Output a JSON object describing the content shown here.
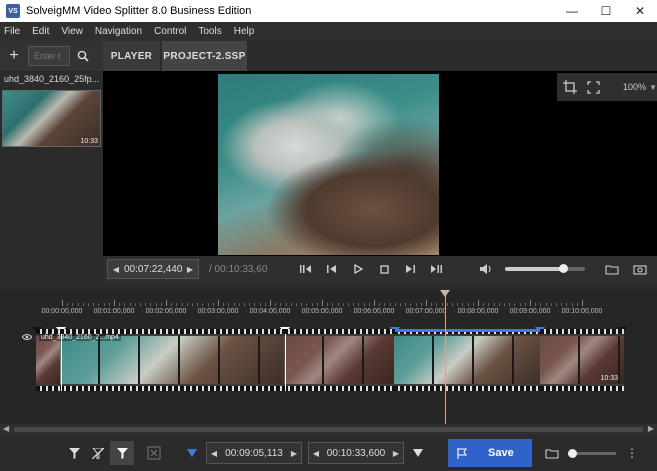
{
  "window": {
    "app_icon": "VS",
    "title": "SolveigMM Video Splitter 8.0 Business Edition",
    "minimize": "—",
    "maximize": "☐",
    "close": "✕"
  },
  "menu": [
    "File",
    "Edit",
    "View",
    "Navigation",
    "Control",
    "Tools",
    "Help"
  ],
  "library": {
    "add_label": "+",
    "search_placeholder": "Enter t",
    "file_name": "uhd_3840_2160_25fp...",
    "thumb_duration": "10:33"
  },
  "tabs": {
    "player": "PLAYER",
    "project": "PROJECT-2.SSP"
  },
  "view": {
    "zoom": "100%"
  },
  "transport": {
    "current_time": "00:07:22,440",
    "total_time": "/ 00:10:33,60",
    "volume_level": 0.72
  },
  "timeline": {
    "ticks": [
      "00:00:00,000",
      "00:01:00,000",
      "00:02:00,000",
      "00:03:00,000",
      "00:04:00,000",
      "00:05:00,000",
      "00:06:00,000",
      "00:07:00,000",
      "00:08:00,000",
      "00:09:00,000",
      "00:10:00,000"
    ],
    "track_label": "uhd_3840_2160_2...mp4",
    "track_duration": "10:33"
  },
  "bottom": {
    "start_time": "00:09:05,113",
    "end_time": "00:10:33,600",
    "save_label": "Save",
    "more": "⋮"
  },
  "colors": {
    "accent": "#2f63c9",
    "selection": "#3d7be0",
    "playhead": "#e8a07a"
  }
}
